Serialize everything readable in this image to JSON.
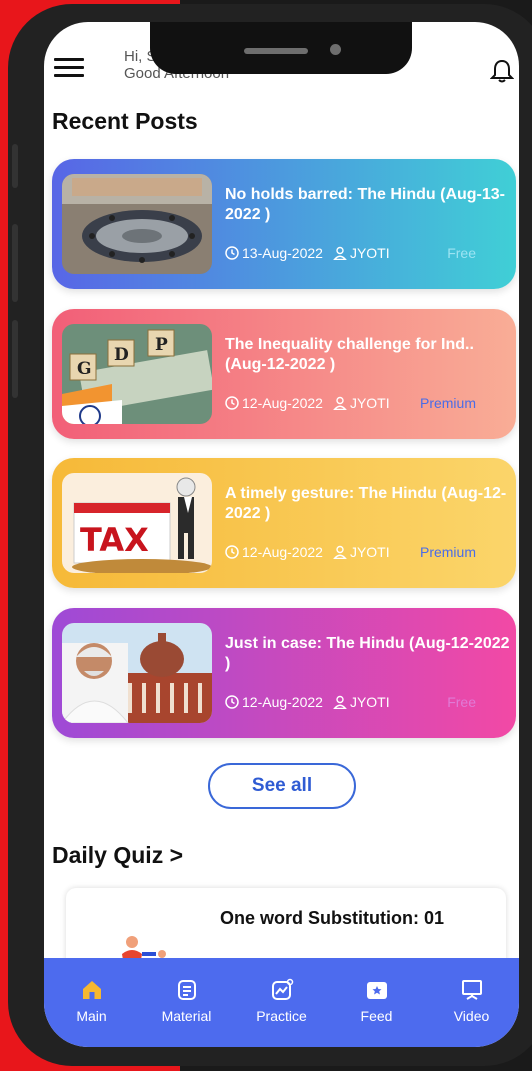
{
  "header": {
    "greeting_line1": "Hi, S",
    "greeting_line2": "Good Afternoon"
  },
  "recent_posts": {
    "title": "Recent Posts",
    "posts": [
      {
        "title": "No holds barred: The Hindu (Aug-13-2022 )",
        "date": "13-Aug-2022",
        "author": "JYOTI",
        "tier": "Free",
        "gradient": [
          "#5866e6",
          "#40cfd6"
        ],
        "badge_color": "#9ce3f2"
      },
      {
        "title": "The Inequality challenge for Ind.. (Aug-12-2022 )",
        "date": "12-Aug-2022",
        "author": "JYOTI",
        "tier": "Premium",
        "gradient": [
          "#f25f78",
          "#f9ad96"
        ],
        "badge_color": "#4a6ce8"
      },
      {
        "title": "A timely gesture: The Hindu (Aug-12-2022 )",
        "date": "12-Aug-2022",
        "author": "JYOTI",
        "tier": "Premium",
        "gradient": [
          "#f6b938",
          "#fbd56a"
        ],
        "badge_color": "#4a6ce8"
      },
      {
        "title": "Just in case: The Hindu (Aug-12-2022 )",
        "date": "12-Aug-2022",
        "author": "JYOTI",
        "tier": "Free",
        "gradient": [
          "#9e4ad6",
          "#f249a5"
        ],
        "badge_color": "#e07ad6"
      }
    ],
    "see_all_label": "See all"
  },
  "daily_quiz": {
    "title": "Daily Quiz >",
    "card_title": "One word Substitution: 01"
  },
  "bottom_nav": {
    "items": [
      {
        "label": "Main",
        "icon": "home-icon",
        "active": true
      },
      {
        "label": "Material",
        "icon": "document-icon",
        "active": false
      },
      {
        "label": "Practice",
        "icon": "chart-icon",
        "active": false
      },
      {
        "label": "Feed",
        "icon": "feed-icon",
        "active": false
      },
      {
        "label": "Video",
        "icon": "monitor-icon",
        "active": false
      }
    ]
  },
  "colors": {
    "brand_red": "#e8161b",
    "nav_blue": "#4d6bee",
    "see_all_blue": "#2f5bd3"
  }
}
